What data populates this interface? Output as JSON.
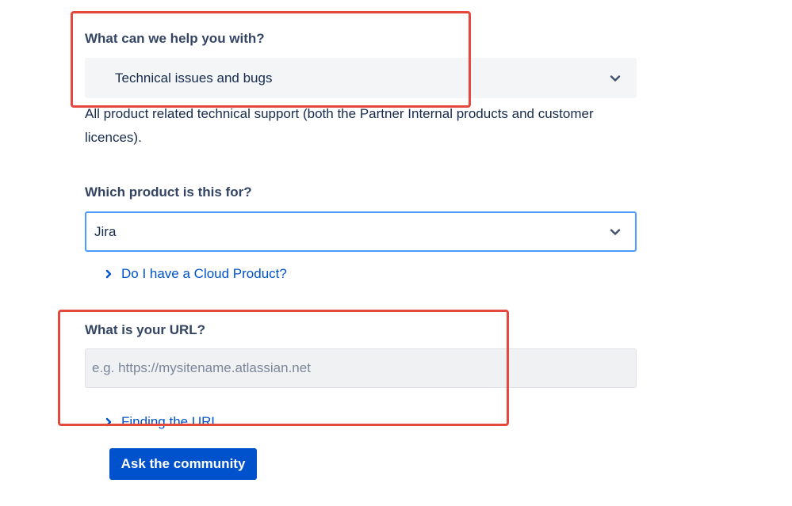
{
  "help_section": {
    "label": "What can we help you with?",
    "selected": "Technical issues and bugs",
    "description": "All product related technical support (both the Partner Internal products and customer licences)."
  },
  "product_section": {
    "label": "Which product is this for?",
    "selected": "Jira",
    "help_link": "Do I have a Cloud Product?"
  },
  "url_section": {
    "label": "What is your URL?",
    "placeholder": "e.g. https://mysitename.atlassian.net",
    "value": "",
    "help_link": "Finding the URL"
  },
  "submit": {
    "label": "Ask the community"
  },
  "colors": {
    "accent": "#0052cc",
    "focus_border": "#4c9aff",
    "highlight": "#e5483d",
    "link": "#0052cc"
  },
  "icons": {
    "dropdown": "chevron-down-icon",
    "link_arrow": "chevron-right-icon"
  }
}
